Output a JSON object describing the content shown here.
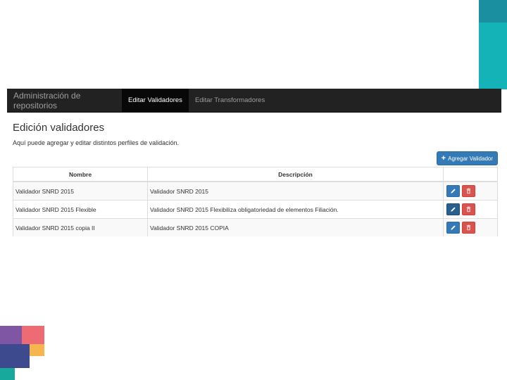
{
  "colors": {
    "navbar_bg": "#222222",
    "primary": "#337ab7",
    "danger": "#d9534f",
    "deco_teal": "#14b3b8",
    "deco_purple": "#7e56a4",
    "deco_pink": "#ef6b74",
    "deco_orange": "#f6b54e",
    "deco_blue": "#3d4a8e"
  },
  "navbar": {
    "brand": "Administración de repositorios",
    "items": [
      {
        "label": "Editar Validadores",
        "active": true
      },
      {
        "label": "Editar Transformadores",
        "active": false
      }
    ]
  },
  "page": {
    "title": "Edición validadores",
    "description": "Aquí puede agregar y editar distintos perfiles de validación.",
    "add_button_label": "Agregar Validador",
    "add_button_icon": "plus-icon"
  },
  "table": {
    "headers": [
      "Nombre",
      "Descripción",
      ""
    ],
    "rows": [
      {
        "name": "Validador SNRD 2015",
        "description": "Validador SNRD 2015"
      },
      {
        "name": "Validador SNRD 2015 Flexible",
        "description": "Validador SNRD 2015 Flexibiliza obligatoriedad de elementos Filiación."
      },
      {
        "name": "Validador SNRD 2015 copia II",
        "description": "Validador SNRD 2015 COPIA"
      }
    ],
    "row_actions": {
      "edit_icon": "pencil-icon",
      "delete_icon": "trash-icon"
    }
  }
}
